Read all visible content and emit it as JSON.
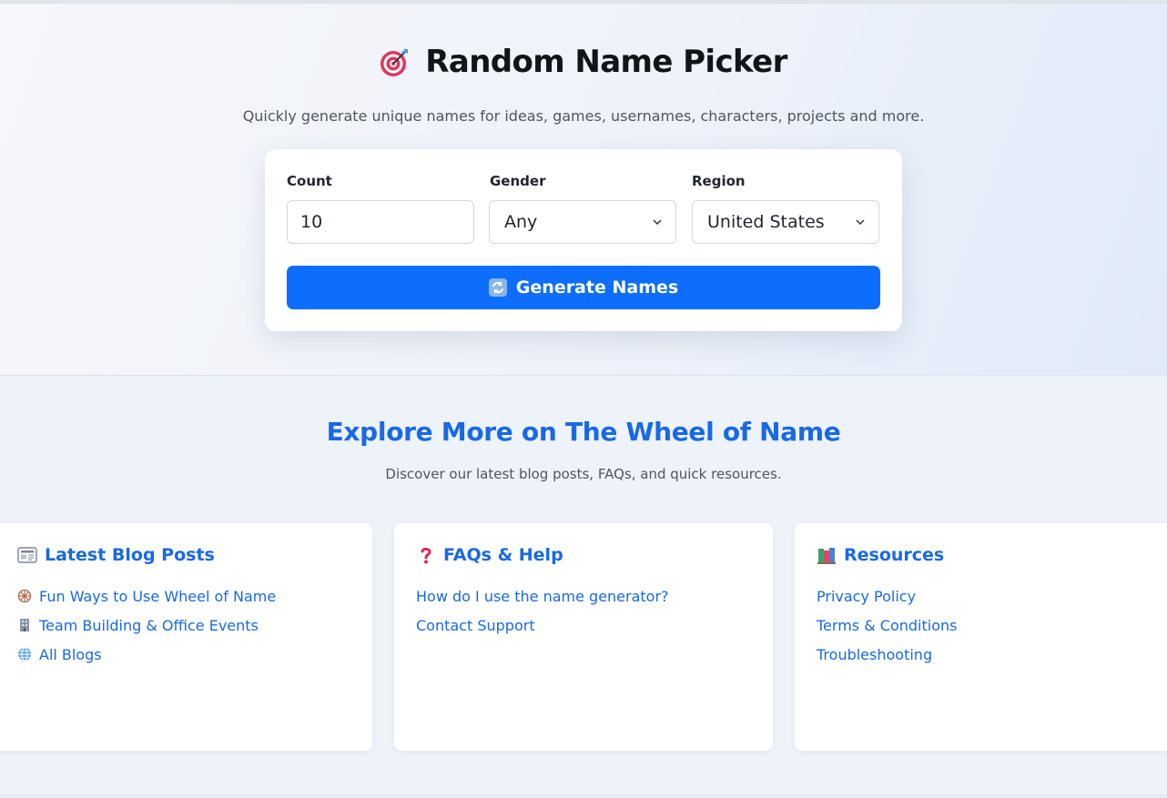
{
  "hero": {
    "title": "Random Name Picker",
    "title_icon": "target-dart-icon",
    "subtitle": "Quickly generate unique names for ideas, games, usernames, characters, projects and more."
  },
  "form": {
    "count_label": "Count",
    "count_value": "10",
    "gender_label": "Gender",
    "gender_value": "Any",
    "region_label": "Region",
    "region_value": "United States",
    "generate_icon": "refresh-icon",
    "generate_label": "Generate Names"
  },
  "explore": {
    "title": "Explore More on The Wheel of Name",
    "subtitle": "Discover our latest blog posts, FAQs, and quick resources."
  },
  "panels": [
    {
      "title": "Latest Blog Posts",
      "icon": "newspaper-icon",
      "links": [
        {
          "label": "Fun Ways to Use Wheel of Name",
          "icon": "wheel-icon"
        },
        {
          "label": "Team Building & Office Events",
          "icon": "office-building-icon"
        },
        {
          "label": "All Blogs",
          "icon": "globe-icon"
        }
      ]
    },
    {
      "title": "FAQs & Help",
      "icon": "question-mark-icon",
      "links": [
        {
          "label": "How do I use the name generator?"
        },
        {
          "label": "Contact Support"
        }
      ]
    },
    {
      "title": "Resources",
      "icon": "books-icon",
      "links": [
        {
          "label": "Privacy Policy"
        },
        {
          "label": "Terms & Conditions"
        },
        {
          "label": "Troubleshooting"
        }
      ]
    }
  ],
  "colors": {
    "accent": "#0d6efd",
    "link": "#1769e8",
    "heading": "#111418"
  }
}
